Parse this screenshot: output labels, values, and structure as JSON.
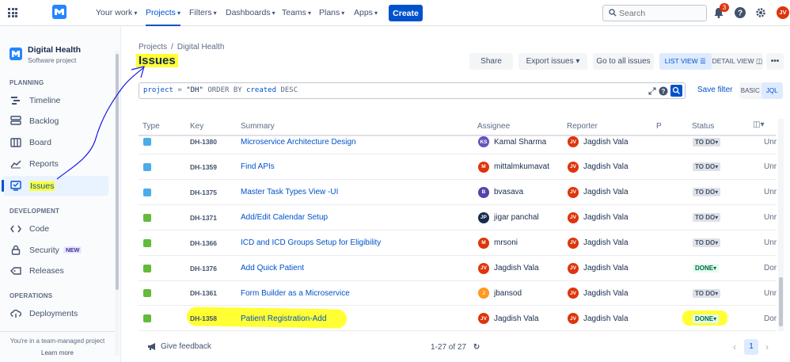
{
  "topnav": {
    "items": [
      {
        "label": "Your work",
        "active": false
      },
      {
        "label": "Projects",
        "active": true
      },
      {
        "label": "Filters",
        "active": false
      },
      {
        "label": "Dashboards",
        "active": false
      },
      {
        "label": "Teams",
        "active": false
      },
      {
        "label": "Plans",
        "active": false
      },
      {
        "label": "Apps",
        "active": false
      }
    ],
    "create_label": "Create",
    "search_placeholder": "Search",
    "notification_count": "3",
    "user_initials": "JV"
  },
  "sidebar": {
    "project_name": "Digital Health",
    "project_type": "Software project",
    "planning_header": "PLANNING",
    "planning_items": [
      {
        "label": "Timeline",
        "icon": "timeline-icon"
      },
      {
        "label": "Backlog",
        "icon": "backlog-icon"
      },
      {
        "label": "Board",
        "icon": "board-icon"
      },
      {
        "label": "Reports",
        "icon": "reports-icon"
      },
      {
        "label": "Issues",
        "icon": "issues-icon",
        "selected": true
      }
    ],
    "development_header": "DEVELOPMENT",
    "development_items": [
      {
        "label": "Code",
        "icon": "code-icon"
      },
      {
        "label": "Security",
        "icon": "security-icon",
        "tag": "NEW"
      },
      {
        "label": "Releases",
        "icon": "releases-icon"
      }
    ],
    "operations_header": "OPERATIONS",
    "operations_items": [
      {
        "label": "Deployments",
        "icon": "deployments-icon"
      }
    ],
    "footer_text": "You're in a team-managed project",
    "footer_link": "Learn more"
  },
  "main": {
    "breadcrumb": [
      "Projects",
      "Digital Health"
    ],
    "breadcrumb_sep": "/",
    "title": "Issues",
    "share_label": "Share",
    "export_label": "Export issues",
    "goto_label": "Go to all issues",
    "list_view_label": "LIST VIEW",
    "detail_view_label": "DETAIL VIEW",
    "jql": {
      "field": "project",
      "op": "=",
      "value": "\"DH\"",
      "order": "ORDER BY",
      "order_field": "created",
      "dir": "DESC"
    },
    "save_filter_label": "Save filter",
    "basic_label": "BASIC",
    "jql_label": "JQL"
  },
  "table": {
    "headers": [
      "Type",
      "Key",
      "Summary",
      "Assignee",
      "Reporter",
      "P",
      "Status"
    ],
    "rows": [
      {
        "type": "task",
        "key": "DH-1380",
        "summary": "Microservice Architecture Design",
        "assignee": "Kamal Sharma",
        "assignee_initials": "KS",
        "assignee_color": "#6554c0",
        "reporter": "Jagdish Vala",
        "status": "TO DO",
        "resolution": "Unr"
      },
      {
        "type": "task",
        "key": "DH-1359",
        "summary": "Find APIs",
        "assignee": "mittalmkumavat",
        "assignee_initials": "M",
        "assignee_color": "#de350b",
        "reporter": "Jagdish Vala",
        "status": "TO DO",
        "resolution": "Unr"
      },
      {
        "type": "task",
        "key": "DH-1375",
        "summary": "Master Task Types View -UI",
        "assignee": "bvasava",
        "assignee_initials": "B",
        "assignee_color": "#5243aa",
        "reporter": "Jagdish Vala",
        "status": "TO DO",
        "resolution": "Unr"
      },
      {
        "type": "story",
        "key": "DH-1371",
        "summary": "Add/Edit Calendar Setup",
        "assignee": "jigar panchal",
        "assignee_initials": "JP",
        "assignee_color": "#172b4d",
        "reporter": "Jagdish Vala",
        "status": "TO DO",
        "resolution": "Unr"
      },
      {
        "type": "story",
        "key": "DH-1366",
        "summary": "ICD and ICD Groups Setup for Eligibility",
        "assignee": "mrsoni",
        "assignee_initials": "M",
        "assignee_color": "#de350b",
        "reporter": "Jagdish Vala",
        "status": "TO DO",
        "resolution": "Unr"
      },
      {
        "type": "story",
        "key": "DH-1376",
        "summary": "Add Quick Patient",
        "assignee": "Jagdish Vala",
        "assignee_initials": "JV",
        "assignee_color": "#de350b",
        "reporter": "Jagdish Vala",
        "status": "DONE",
        "resolution": "Dor"
      },
      {
        "type": "story",
        "key": "DH-1361",
        "summary": "Form Builder as a Microservice",
        "assignee": "jbansod",
        "assignee_initials": "J",
        "assignee_color": "#ff991f",
        "reporter": "Jagdish Vala",
        "status": "TO DO",
        "resolution": "Unr"
      },
      {
        "type": "story",
        "key": "DH-1358",
        "summary": "Patient Registration-Add",
        "assignee": "Jagdish Vala",
        "assignee_initials": "JV",
        "assignee_color": "#de350b",
        "reporter": "Jagdish Vala",
        "status": "DONE",
        "resolution": "Dor"
      }
    ],
    "reporter_initials": "JV"
  },
  "footer": {
    "feedback_label": "Give feedback",
    "count_label": "1-27 of 27",
    "current_page": "1"
  },
  "colors": {
    "accent": "#0052cc",
    "highlight": "#ffff33",
    "annotation": "#1a1ae6"
  }
}
